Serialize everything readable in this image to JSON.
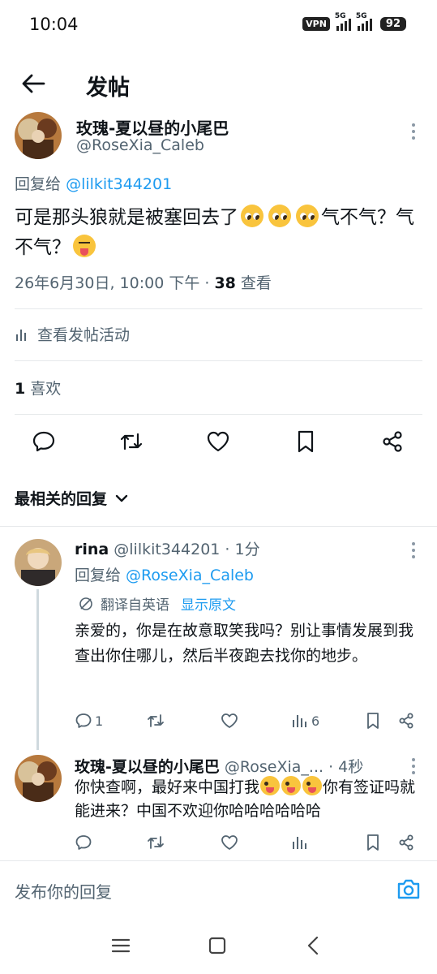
{
  "status_bar": {
    "time": "10:04",
    "vpn": "VPN",
    "net1": "5G",
    "net2": "5G",
    "battery": "92"
  },
  "header": {
    "title": "发帖"
  },
  "post": {
    "author_name": "玫瑰-夏以昼的小尾巴",
    "author_handle": "@RoseXia_Caleb",
    "reply_prefix": "回复给",
    "reply_to": "@lilkit344201",
    "text_1": "可是那头狼就是被塞回去了",
    "text_2": "气不气？气不气？",
    "date": "26年6月30日, 10:00 下午 · ",
    "views_count": "38",
    "views_label": " 查看",
    "activity_label": "查看发帖活动",
    "likes_count": "1",
    "likes_label": " 喜欢"
  },
  "replies_section": {
    "sort_label": "最相关的回复"
  },
  "reply_1": {
    "name": "rina",
    "handle_time": " @lilkit344201 · 1分",
    "reply_prefix": "回复给 ",
    "reply_to": "@RoseXia_Caleb",
    "translate_label": "翻译自英语",
    "show_original": "显示原文",
    "text": "亲爱的，你是在故意取笑我吗？别让事情发展到我查出你住哪儿，然后半夜跑去找你的地步。",
    "reply_count": "1",
    "view_count": "6"
  },
  "reply_2": {
    "name": "玫瑰-夏以昼的小尾巴",
    "handle_time": " @RoseXia_... · 4秒",
    "text_1": "你快查啊，最好来中国打我",
    "text_2": "你有签证吗就能进来？中国不欢迎你哈哈哈哈哈哈"
  },
  "compose": {
    "placeholder": "发布你的回复"
  },
  "colors": {
    "accent": "#1d9bf0",
    "text_primary": "#0f1419",
    "text_secondary": "#536471",
    "divider": "#e6e9eb"
  },
  "icons": [
    "back-arrow-icon",
    "more-vertical-icon",
    "bar-chart-icon",
    "reply-icon",
    "retweet-icon",
    "heart-icon",
    "bookmark-icon",
    "share-icon",
    "chevron-down-icon",
    "translate-icon",
    "camera-icon",
    "menu-icon",
    "home-square-icon",
    "back-chevron-icon"
  ]
}
